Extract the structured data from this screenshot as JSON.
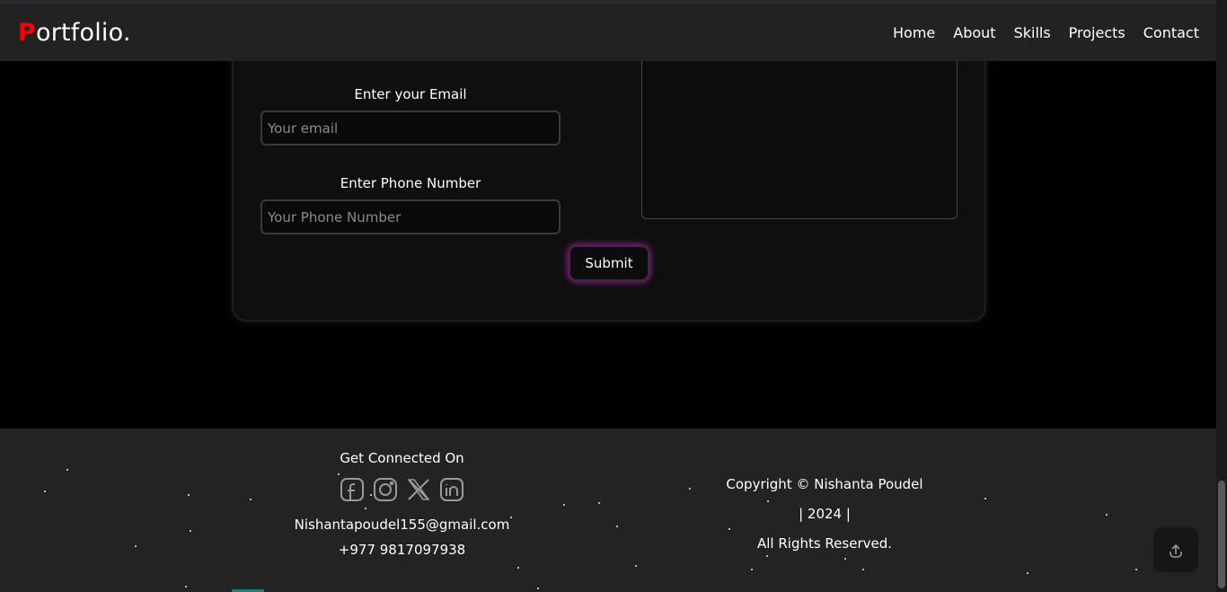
{
  "nav": {
    "logo_first": "P",
    "logo_rest": "ortfolio.",
    "links": [
      "Home",
      "About",
      "Skills",
      "Projects",
      "Contact"
    ]
  },
  "form": {
    "email_label": "Enter your Email",
    "email_placeholder": "Your email",
    "phone_label": "Enter Phone Number",
    "phone_placeholder": "Your Phone Number",
    "submit_label": "Submit"
  },
  "footer": {
    "connect_title": "Get Connected On",
    "social_icons": [
      "facebook-icon",
      "instagram-icon",
      "x-icon",
      "linkedin-icon"
    ],
    "email": "Nishantapoudel155@gmail.com",
    "phone": "+977 9817097938",
    "copyright_line1": "Copyright © Nishanta Poudel",
    "copyright_line2": "| 2024 |",
    "copyright_line3": "All Rights Reserved."
  },
  "colors": {
    "accent_red": "#ff0000",
    "submit_glow": "#b02cb0",
    "navbar_bg": "#222222",
    "footer_bg": "#232323"
  }
}
